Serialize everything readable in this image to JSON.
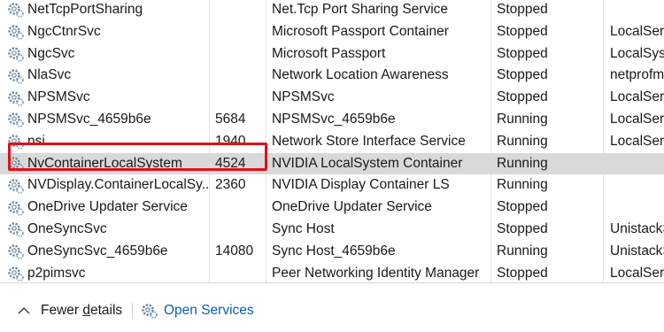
{
  "services": [
    {
      "name": "NetTcpPortSharing",
      "pid": "",
      "description": "Net.Tcp Port Sharing Service",
      "status": "Stopped",
      "logon": ""
    },
    {
      "name": "NgcCtnrSvc",
      "pid": "",
      "description": "Microsoft Passport Container",
      "status": "Stopped",
      "logon": "LocalServ"
    },
    {
      "name": "NgcSvc",
      "pid": "",
      "description": "Microsoft Passport",
      "status": "Stopped",
      "logon": "LocalSyst"
    },
    {
      "name": "NlaSvc",
      "pid": "",
      "description": "Network Location Awareness",
      "status": "Stopped",
      "logon": "netprofm"
    },
    {
      "name": "NPSMSvc",
      "pid": "",
      "description": "NPSMSvc",
      "status": "Stopped",
      "logon": "LocalServ"
    },
    {
      "name": "NPSMSvc_4659b6e",
      "pid": "5684",
      "description": "NPSMSvc_4659b6e",
      "status": "Running",
      "logon": "LocalServ"
    },
    {
      "name": "nsi",
      "pid": "1940",
      "description": "Network Store Interface Service",
      "status": "Running",
      "logon": "LocalServ"
    },
    {
      "name": "NvContainerLocalSystem",
      "pid": "4524",
      "description": "NVIDIA LocalSystem Container",
      "status": "Running",
      "logon": "",
      "selected": true
    },
    {
      "name": "NVDisplay.ContainerLocalSy...",
      "pid": "2360",
      "description": "NVIDIA Display Container LS",
      "status": "Running",
      "logon": ""
    },
    {
      "name": "OneDrive Updater Service",
      "pid": "",
      "description": "OneDrive Updater Service",
      "status": "Stopped",
      "logon": ""
    },
    {
      "name": "OneSyncSvc",
      "pid": "",
      "description": "Sync Host",
      "status": "Stopped",
      "logon": "UnistackS"
    },
    {
      "name": "OneSyncSvc_4659b6e",
      "pid": "14080",
      "description": "Sync Host_4659b6e",
      "status": "Running",
      "logon": "UnistackS"
    },
    {
      "name": "p2pimsvc",
      "pid": "",
      "description": "Peer Networking Identity Manager",
      "status": "Stopped",
      "logon": "LocalServ"
    }
  ],
  "footer": {
    "fewer_details_prefix": "Fewer ",
    "fewer_details_underlined": "d",
    "fewer_details_suffix": "etails",
    "open_services_label": "Open Services"
  },
  "icons": {
    "service": "gear-icon",
    "collapse": "chevron-up-icon",
    "open_services": "services-gear-icon"
  },
  "colors": {
    "selection": "#d9d9d9",
    "highlight_border": "#e0101a",
    "link": "#0a5fb4"
  }
}
